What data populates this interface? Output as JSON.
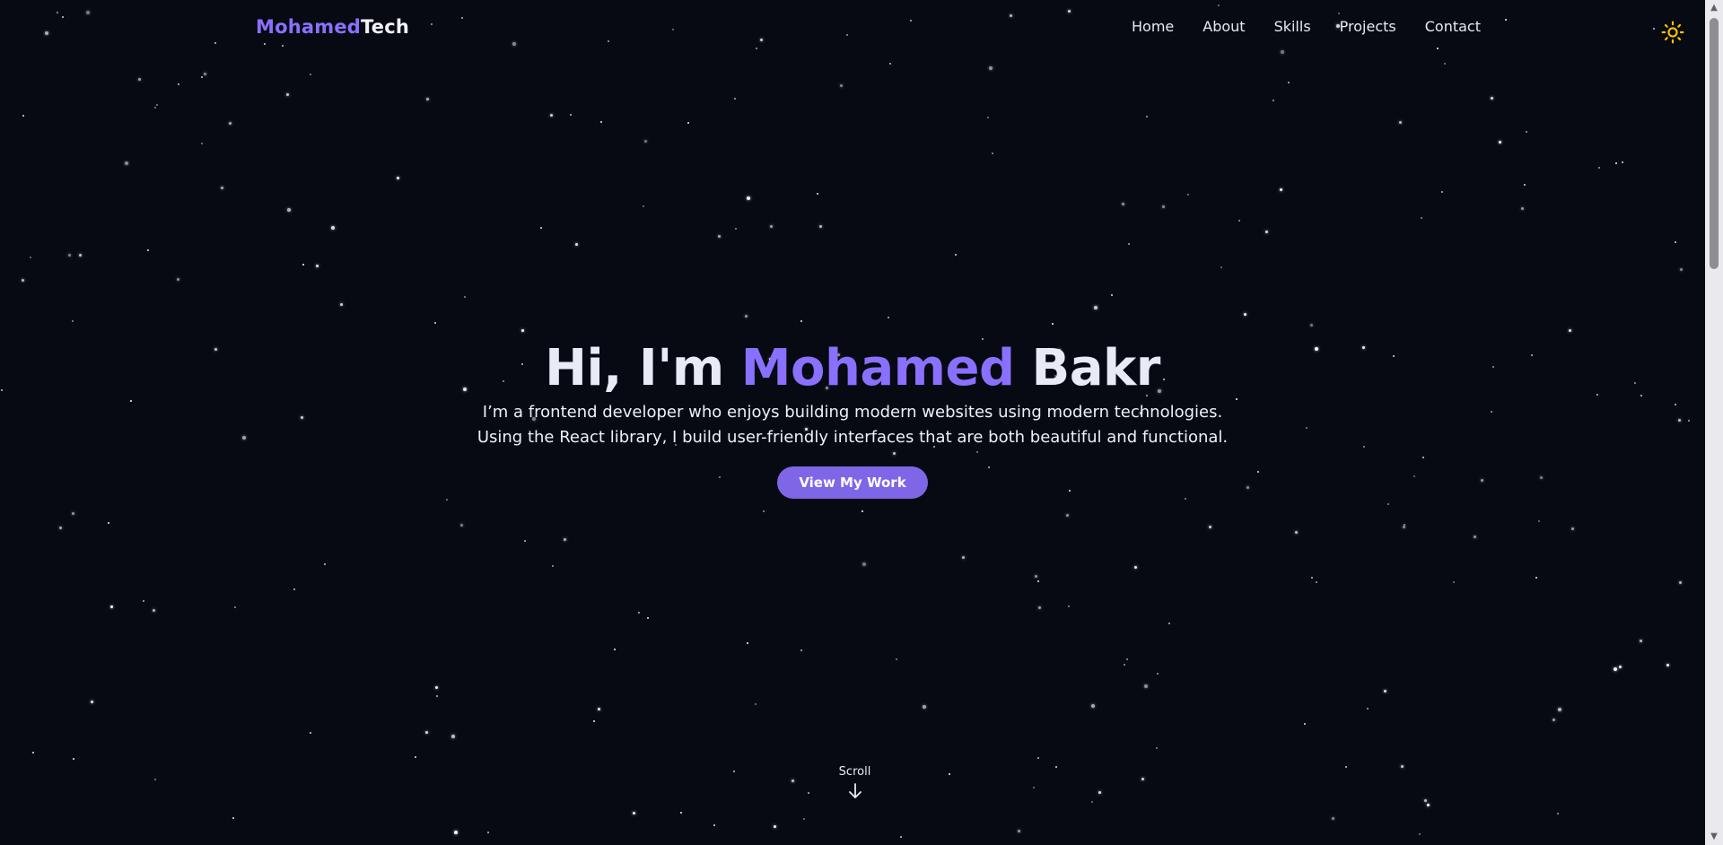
{
  "nav": {
    "logo_primary": "Mohamed",
    "logo_secondary": "Tech",
    "items": [
      {
        "label": "Home"
      },
      {
        "label": "About"
      },
      {
        "label": "Skills"
      },
      {
        "label": "Projects"
      },
      {
        "label": "Contact"
      }
    ],
    "theme_icon": "sun-icon"
  },
  "hero": {
    "greeting": "Hi, I'm",
    "first_name": "Mohamed",
    "last_name": "Bakr",
    "line1": "I’m a frontend developer who enjoys building modern websites using modern technologies.",
    "line2": "Using the React library, I build user-friendly interfaces that are both beautiful and functional.",
    "cta_label": "View My Work"
  },
  "scroll": {
    "label": "Scroll",
    "icon": "arrow-down-icon"
  },
  "colors": {
    "background": "#070a12",
    "accent": "#8a70ff",
    "button": "#7f66e6",
    "sun": "#ffc400"
  }
}
